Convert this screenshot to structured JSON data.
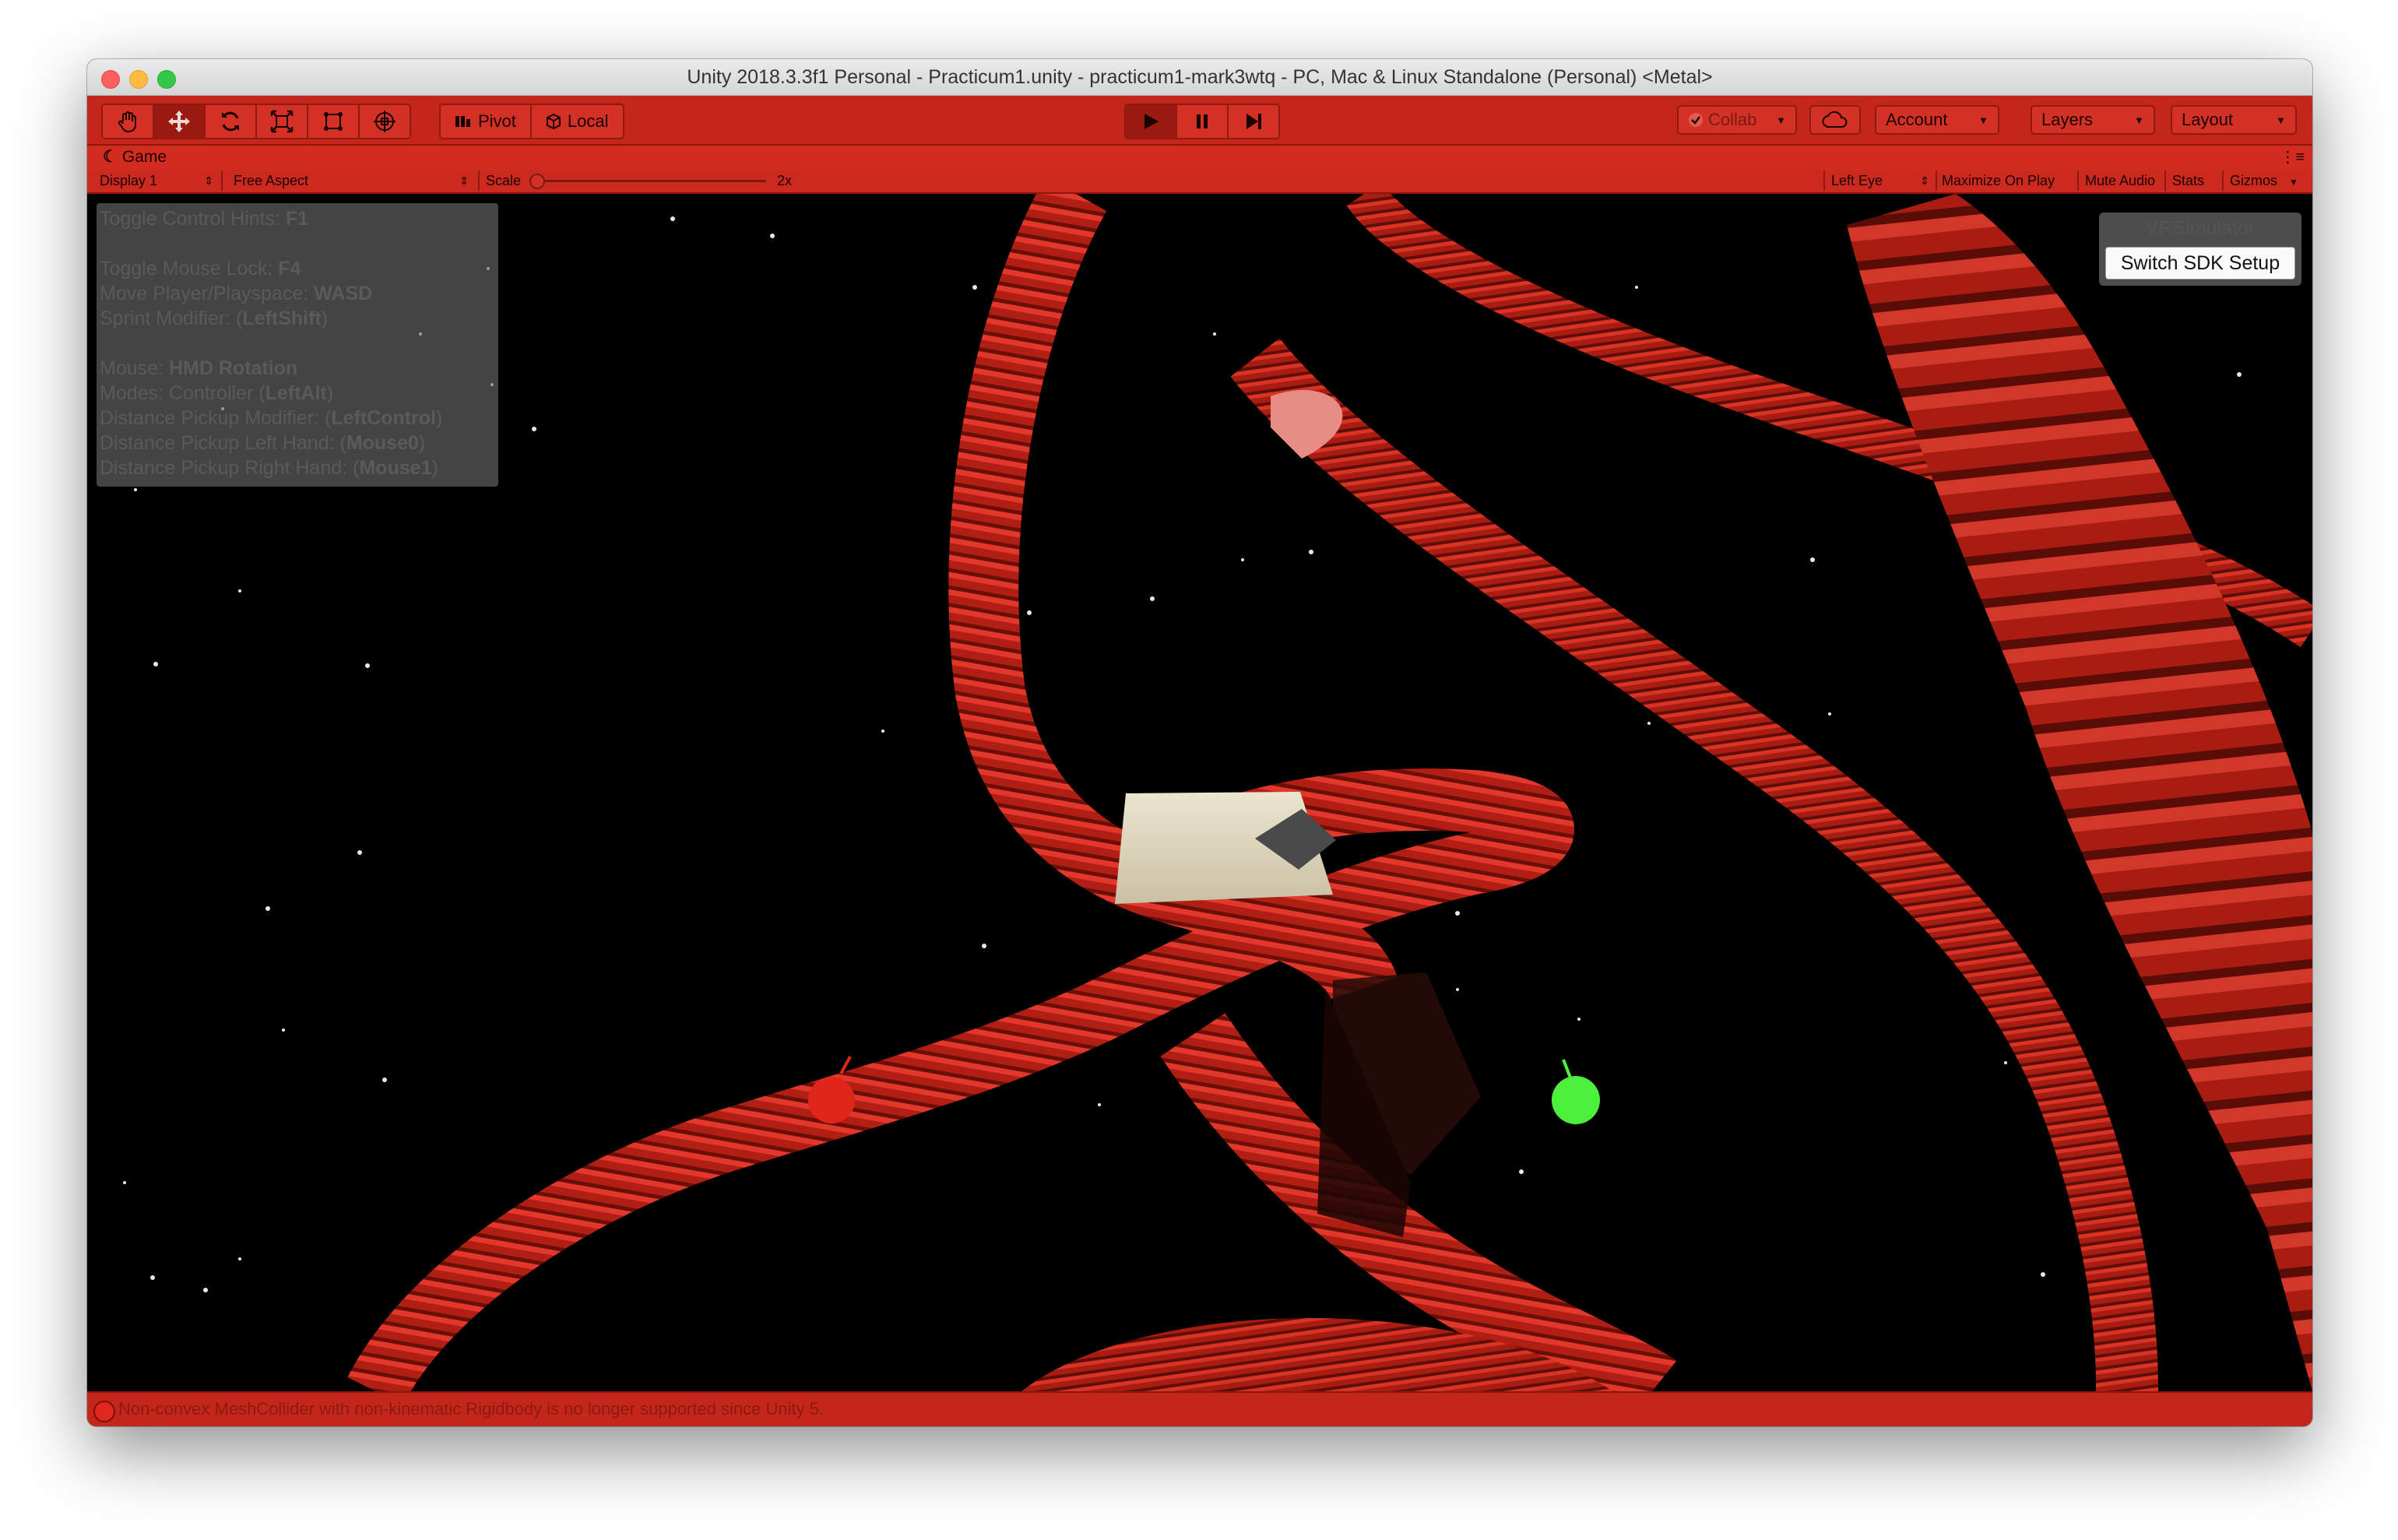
{
  "window": {
    "title": "Unity 2018.3.3f1 Personal - Practicum1.unity - practicum1-mark3wtq - PC, Mac & Linux Standalone (Personal) <Metal>"
  },
  "toolbar": {
    "tools": [
      "hand-icon",
      "move-icon",
      "rotate-icon",
      "scale-icon",
      "rect-tool-icon",
      "transform-icon"
    ],
    "pivot_label": "Pivot",
    "local_label": "Local",
    "collab_label": "Collab",
    "account_label": "Account",
    "layers_label": "Layers",
    "layout_label": "Layout"
  },
  "game_tab": {
    "label": "Game"
  },
  "game_bar": {
    "display": "Display 1",
    "aspect": "Free Aspect",
    "scale_label": "Scale",
    "scale_value": "2x",
    "eye": "Left Eye",
    "maximize": "Maximize On Play",
    "mute": "Mute Audio",
    "stats": "Stats",
    "gizmos": "Gizmos"
  },
  "hints": {
    "toggle_hints": "Toggle Control Hints: ",
    "toggle_hints_key": "F1",
    "mouse_lock": "Toggle Mouse Lock: ",
    "mouse_lock_key": "F4",
    "move": "Move Player/Playspace: ",
    "move_key": "WASD",
    "sprint": "Sprint Modifier: (",
    "sprint_key": "LeftShift",
    "mouse": "Mouse: ",
    "mouse_key": "HMD Rotation",
    "modes": "Modes: Controller (",
    "modes_key": "LeftAlt",
    "dist_mod": "Distance Pickup Modifier: (",
    "dist_mod_key": "LeftControl",
    "dist_left": "Distance Pickup Left Hand: (",
    "dist_left_key": "Mouse0",
    "dist_right": "Distance Pickup Right Hand: (",
    "dist_right_key": "Mouse1",
    "close_paren": ")"
  },
  "vr": {
    "title": "VRSimulator",
    "button": "Switch SDK Setup"
  },
  "status": {
    "message": "Non-convex MeshCollider with non-kinematic Rigidbody is no longer supported since Unity 5."
  },
  "colors": {
    "editor_tint": "#c4261c",
    "stairs": "#b01e14",
    "controller_left": "#e0261a",
    "controller_right": "#4cf03c"
  }
}
